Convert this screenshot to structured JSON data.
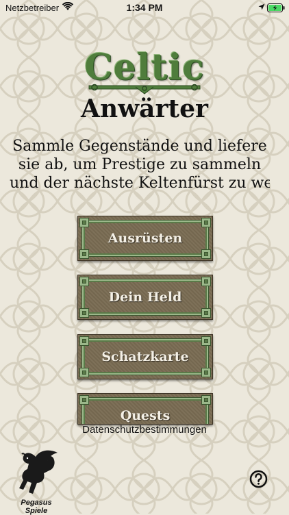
{
  "status_bar": {
    "carrier": "Netzbetreiber",
    "time": "1:34 PM",
    "icons": [
      "wifi-icon",
      "location-arrow-icon",
      "battery-charging-icon"
    ],
    "battery_color": "#4cd964"
  },
  "logo": {
    "title": "Celtic",
    "subtitle": "Anwärter",
    "title_color": "#4f7d3c"
  },
  "intro": {
    "lines": [
      "Sammle Gegenstände und liefere",
      "sie ab, um Prestige zu sammeln",
      "und der nächste Keltenfürst zu werd"
    ]
  },
  "menu": {
    "buttons": [
      {
        "label": "Ausrüsten"
      },
      {
        "label": "Dein Held"
      },
      {
        "label": "Schatzkarte"
      },
      {
        "label": "Quests"
      }
    ],
    "button_color": "#796b52",
    "frame_color": "#9bb88a"
  },
  "footer": {
    "privacy_link": "Datenschutzbestimmungen",
    "publisher": "Pegasus Spiele",
    "help_icon": "question-circle-icon"
  }
}
